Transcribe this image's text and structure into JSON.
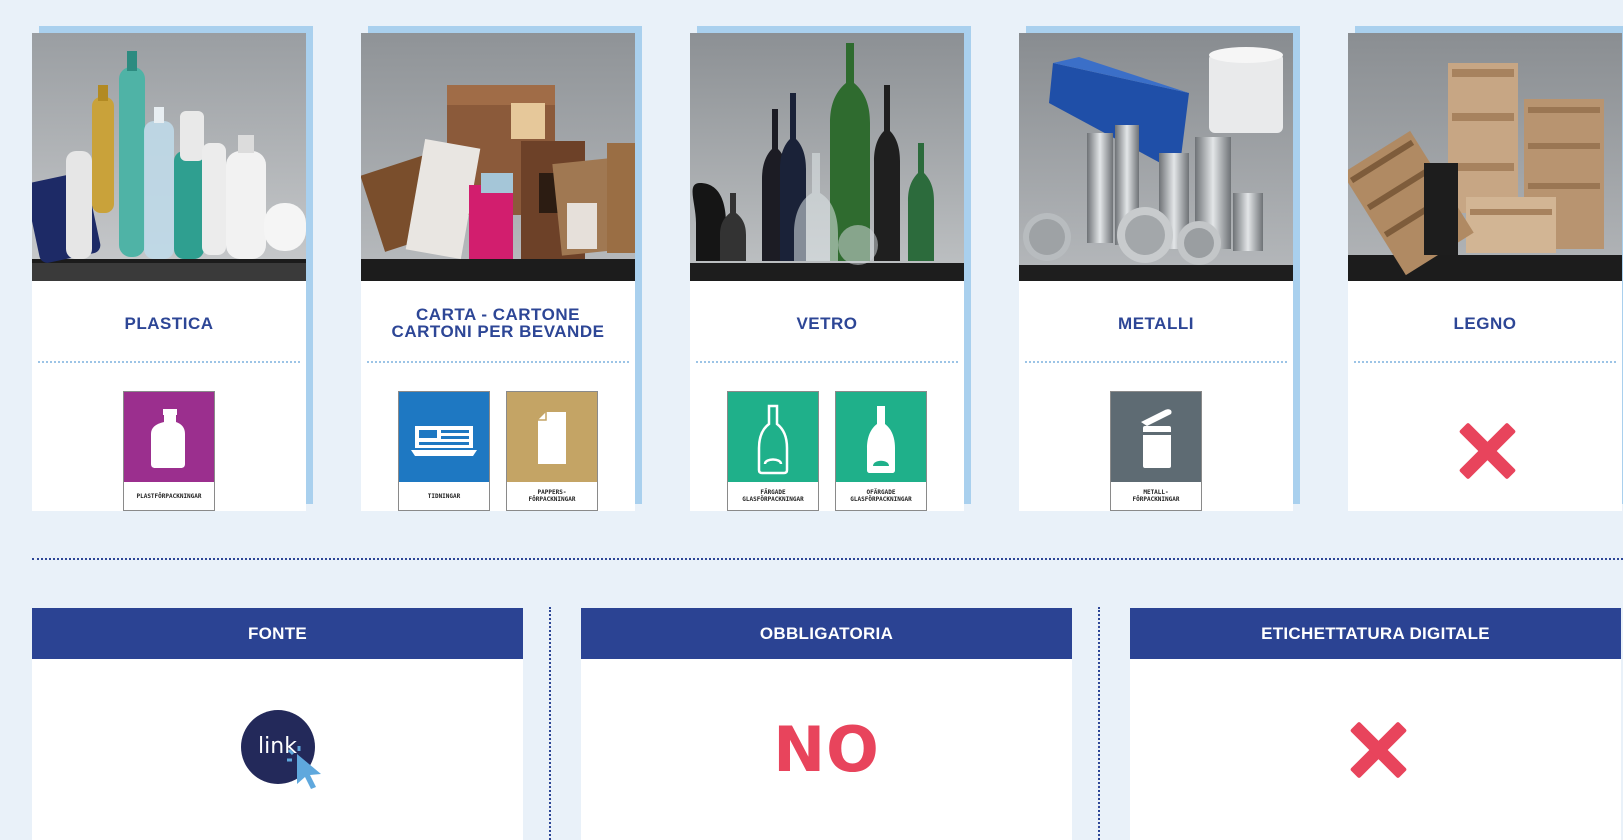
{
  "materials": [
    {
      "title": "PLASTICA",
      "bins": [
        {
          "label": "PLASTFÖRPACKNINGAR",
          "color": "#9b2f8e",
          "icon": "plastic-bottle-icon"
        }
      ]
    },
    {
      "title": "CARTA - CARTONE\nCARTONI PER BEVANDE",
      "bins": [
        {
          "label": "TIDNINGAR",
          "color": "#1e78c2",
          "icon": "newspaper-icon"
        },
        {
          "label": "PAPPERS-\nFÖRPACKNINGAR",
          "color": "#c4a465",
          "icon": "carton-icon"
        }
      ]
    },
    {
      "title": "VETRO",
      "bins": [
        {
          "label": "FÄRGADE\nGLASFÖRPACKNINGAR",
          "color": "#1fb08a",
          "icon": "glass-bottle-outline-icon"
        },
        {
          "label": "OFÄRGADE\nGLASFÖRPACKNINGAR",
          "color": "#1fb08a",
          "icon": "glass-bottle-solid-icon"
        }
      ]
    },
    {
      "title": "METALLI",
      "bins": [
        {
          "label": "METALL-\nFÖRPACKNINGAR",
          "color": "#5e6b73",
          "icon": "metal-can-icon"
        }
      ]
    },
    {
      "title": "LEGNO",
      "bins": [],
      "none_icon": "x-icon"
    }
  ],
  "info": {
    "fonte": {
      "title": "FONTE",
      "link_text": "link"
    },
    "obbligatoria": {
      "title": "OBBLIGATORIA",
      "value": "NO"
    },
    "etichettatura": {
      "title": "ETICHETTATURA DIGITALE",
      "icon": "x-icon"
    }
  },
  "colors": {
    "navy": "#2b4393",
    "accent_red": "#e8445c",
    "card_shadow": "#a9d0ee",
    "page_bg": "#e9f1f9"
  }
}
